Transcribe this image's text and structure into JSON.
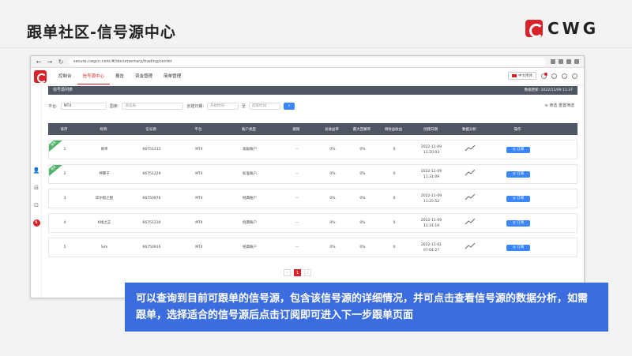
{
  "slide": {
    "title": "跟单社区-信号源中心",
    "brand": "CWG",
    "caption": "可以查询到目前可跟单的信号源，包含该信号源的详细情况，并可点击查看信号源的数据分析，如需跟单，选择适合的信号源后点击订阅即可进入下一步跟单页面"
  },
  "browser": {
    "url": "secure.cwgcn.com/#/documentary/trading/center"
  },
  "app": {
    "nav": [
      "控制台",
      "信号源中心",
      "报告",
      "资金管理",
      "简单管理"
    ],
    "active_nav_index": 1,
    "lang": "中文简体"
  },
  "section": {
    "title": "信号源列表",
    "update_label": "数据更新: 2022/11/09 11:37"
  },
  "filters": {
    "platform_label": "平台:",
    "platform_value": "MT4",
    "country_label": "国家:",
    "country_placeholder": "请选择",
    "date_label": "创建日期:",
    "start_placeholder": "开始时间",
    "to": "至",
    "end_placeholder": "结束时间",
    "filter_text": "≡ 筛选",
    "reset_text": "重置筛选"
  },
  "table": {
    "headers": [
      "排序",
      "昵称",
      "信号源",
      "平台",
      "账户类型",
      "跟随",
      "总收益率",
      "最大回撤率",
      "周收益收益",
      "创建日期",
      "数据分析",
      "操作"
    ],
    "rows": [
      {
        "rank": "1",
        "name": "易单",
        "id": "66751231",
        "platform": "MT4",
        "type": "高级账户",
        "follow": "--",
        "ret": "0%",
        "dd": "0%",
        "week": "0",
        "date": "2022-11-09",
        "time": "11:20:03",
        "tag": "推荐"
      },
      {
        "rank": "2",
        "name": "神算子",
        "id": "66751229",
        "platform": "MT4",
        "type": "标准账户",
        "follow": "--",
        "ret": "0%",
        "dd": "0%",
        "week": "0",
        "date": "2022-11-09",
        "time": "11:31:09",
        "tag": "推荐"
      },
      {
        "rank": "3",
        "name": "华尔街之狼",
        "id": "66750976",
        "platform": "MT4",
        "type": "经典账户",
        "follow": "--",
        "ret": "0%",
        "dd": "0%",
        "week": "0",
        "date": "2022-11-09",
        "time": "11:25:52",
        "tag": ""
      },
      {
        "rank": "4",
        "name": "K线之王",
        "id": "66751230",
        "platform": "MT4",
        "type": "经典账户",
        "follow": "--",
        "ret": "0%",
        "dd": "0%",
        "week": "0",
        "date": "2022-11-09",
        "time": "11:31:19",
        "tag": ""
      },
      {
        "rank": "5",
        "name": "Sim",
        "id": "66750916",
        "platform": "MT4",
        "type": "经典账户",
        "follow": "--",
        "ret": "0%",
        "dd": "0%",
        "week": "0",
        "date": "2022-11-01",
        "time": "07:04:27",
        "tag": ""
      }
    ],
    "subscribe_label": "◎ 订阅"
  },
  "pager": {
    "prev": "‹",
    "current": "1",
    "next": "›"
  }
}
